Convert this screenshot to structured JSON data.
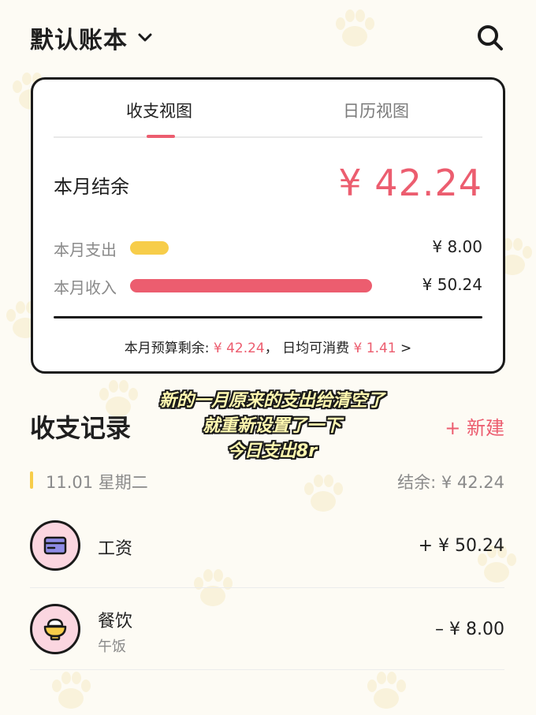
{
  "header": {
    "title": "默认账本"
  },
  "card": {
    "tabs": [
      {
        "label": "收支视图"
      },
      {
        "label": "日历视图"
      }
    ],
    "balance_label": "本月结余",
    "balance_value": "¥ 42.24",
    "expense": {
      "label": "本月支出",
      "value": "¥ 8.00",
      "amount": 8.0
    },
    "income": {
      "label": "本月收入",
      "value": "¥ 50.24",
      "amount": 50.24
    },
    "budget": {
      "remaining_label": "本月预算剩余:",
      "remaining_value": "¥ 42.24",
      "separator": "，",
      "daily_label": "日均可消费",
      "daily_value": "¥ 1.41",
      "arrow": ">"
    }
  },
  "overlay": {
    "line1": "新的一月原来的支出给清空了",
    "line2": "就重新设置了一下",
    "line3": "今日支出8r"
  },
  "records": {
    "title": "收支记录",
    "new_label": "+ 新建",
    "day": {
      "date": "11.01 星期二",
      "balance": "结余: ¥ 42.24"
    },
    "items": [
      {
        "name": "工资",
        "note": "",
        "amount": "+ ¥ 50.24",
        "icon": "wallet-icon"
      },
      {
        "name": "餐饮",
        "note": "午饭",
        "amount": "– ¥ 8.00",
        "icon": "rice-bowl-icon"
      }
    ]
  },
  "colors": {
    "accent": "#ec5d6f",
    "expense_bar": "#f7cd4a",
    "icon_bg": "#fbd6e0",
    "overlay_text": "#fff8b0"
  }
}
